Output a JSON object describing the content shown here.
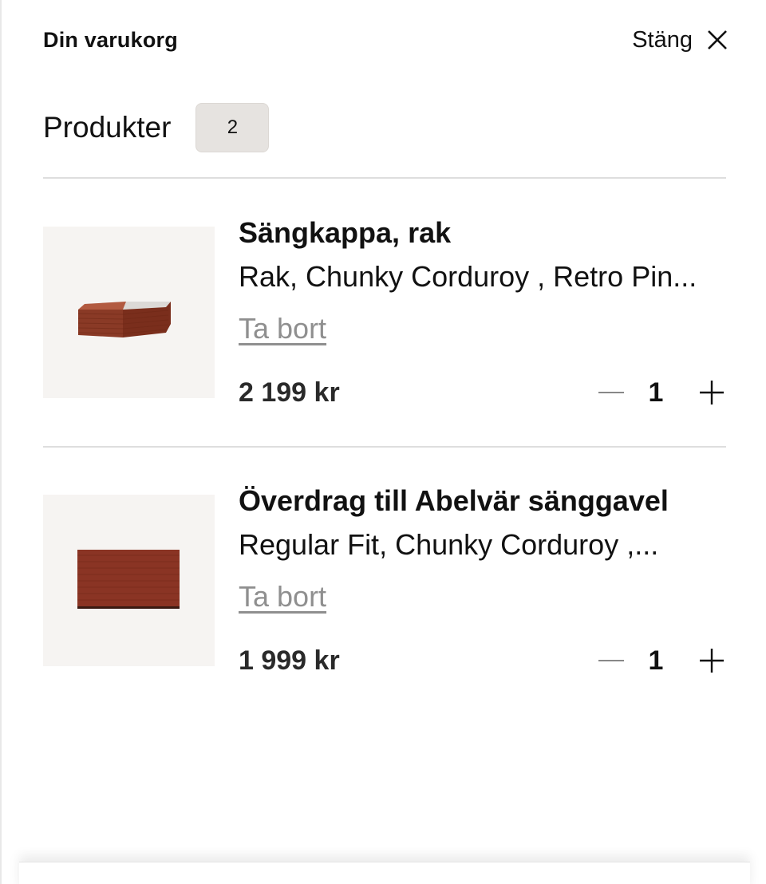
{
  "header": {
    "title": "Din varukorg",
    "close_label": "Stäng"
  },
  "products": {
    "label": "Produkter",
    "count": "2"
  },
  "items": [
    {
      "name": "Sängkappa, rak",
      "variant": "Rak, Chunky Corduroy , Retro Pin...",
      "remove_label": "Ta bort",
      "price": "2 199 kr",
      "quantity": "1",
      "color": "#8a3a26"
    },
    {
      "name": "Överdrag till Abelvär sänggavel",
      "variant": "Regular Fit, Chunky Corduroy ,...",
      "remove_label": "Ta bort",
      "price": "1 999 kr",
      "quantity": "1",
      "color": "#8a3424"
    }
  ]
}
